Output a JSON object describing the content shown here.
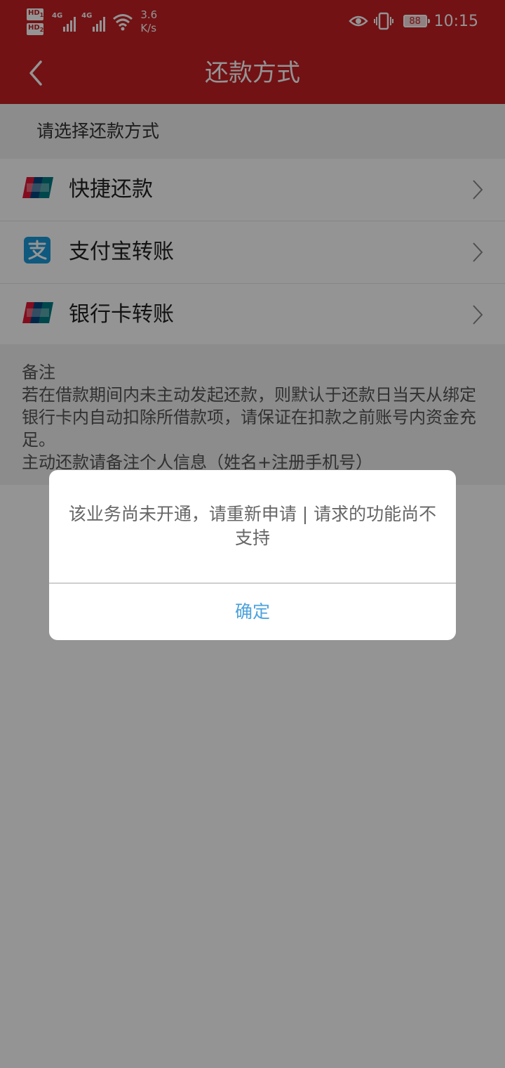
{
  "status_bar": {
    "hd1": "HD",
    "hd1_sub": "1",
    "hd2": "HD",
    "hd2_sub": "2",
    "sig1_label": "4G",
    "sig2_label": "4G",
    "speed_value": "3.6",
    "speed_unit": "K/s",
    "battery": "88",
    "time": "10:15"
  },
  "header": {
    "title": "还款方式"
  },
  "section": {
    "title": "请选择还款方式"
  },
  "methods": [
    {
      "label": "快捷还款",
      "icon": "unionpay-icon"
    },
    {
      "label": "支付宝转账",
      "icon": "alipay-icon"
    },
    {
      "label": "银行卡转账",
      "icon": "unionpay-icon"
    }
  ],
  "notes": {
    "title": "备注",
    "line1": "若在借款期间内未主动发起还款，则默认于还款日当天从绑定银行卡内自动扣除所借款项，请保证在扣款之前账号内资金充足。",
    "line2": "主动还款请备注个人信息（姓名+注册手机号）"
  },
  "dialog": {
    "message": "该业务尚未开通，请重新申请 | 请求的功能尚不支持",
    "ok_label": "确定"
  },
  "colors": {
    "brand_red": "#c41f24",
    "link_blue": "#4ca3dd",
    "alipay_blue": "#1a9ad9"
  }
}
